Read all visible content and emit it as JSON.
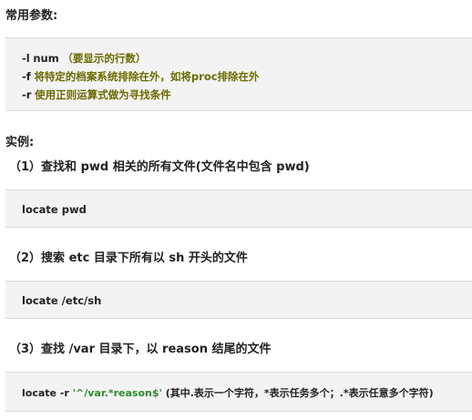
{
  "params_heading": "常用参数:",
  "params": [
    {
      "flag": "-l",
      "arg": "num",
      "desc": "（要显示的行数）"
    },
    {
      "flag": "-f",
      "desc": "将特定的档案系统排除在外，如将proc排除在外"
    },
    {
      "flag": "-r",
      "desc": "使用正则运算式做为寻找条件"
    }
  ],
  "examples_heading": "实例:",
  "examples": [
    {
      "title": "（1）查找和 pwd 相关的所有文件(文件名中包含 pwd)",
      "command": "locate pwd"
    },
    {
      "title": "（2）搜索 etc 目录下所有以 sh 开头的文件",
      "command": "locate /etc/sh"
    },
    {
      "title": "（3）查找 /var 目录下，以 reason 结尾的文件",
      "command_prefix": "locate -r ",
      "command_regex": "'^/var.*reason$'",
      "command_note": " (其中.表示一个字符，*表示任务多个；.*表示任意多个字符)"
    }
  ]
}
